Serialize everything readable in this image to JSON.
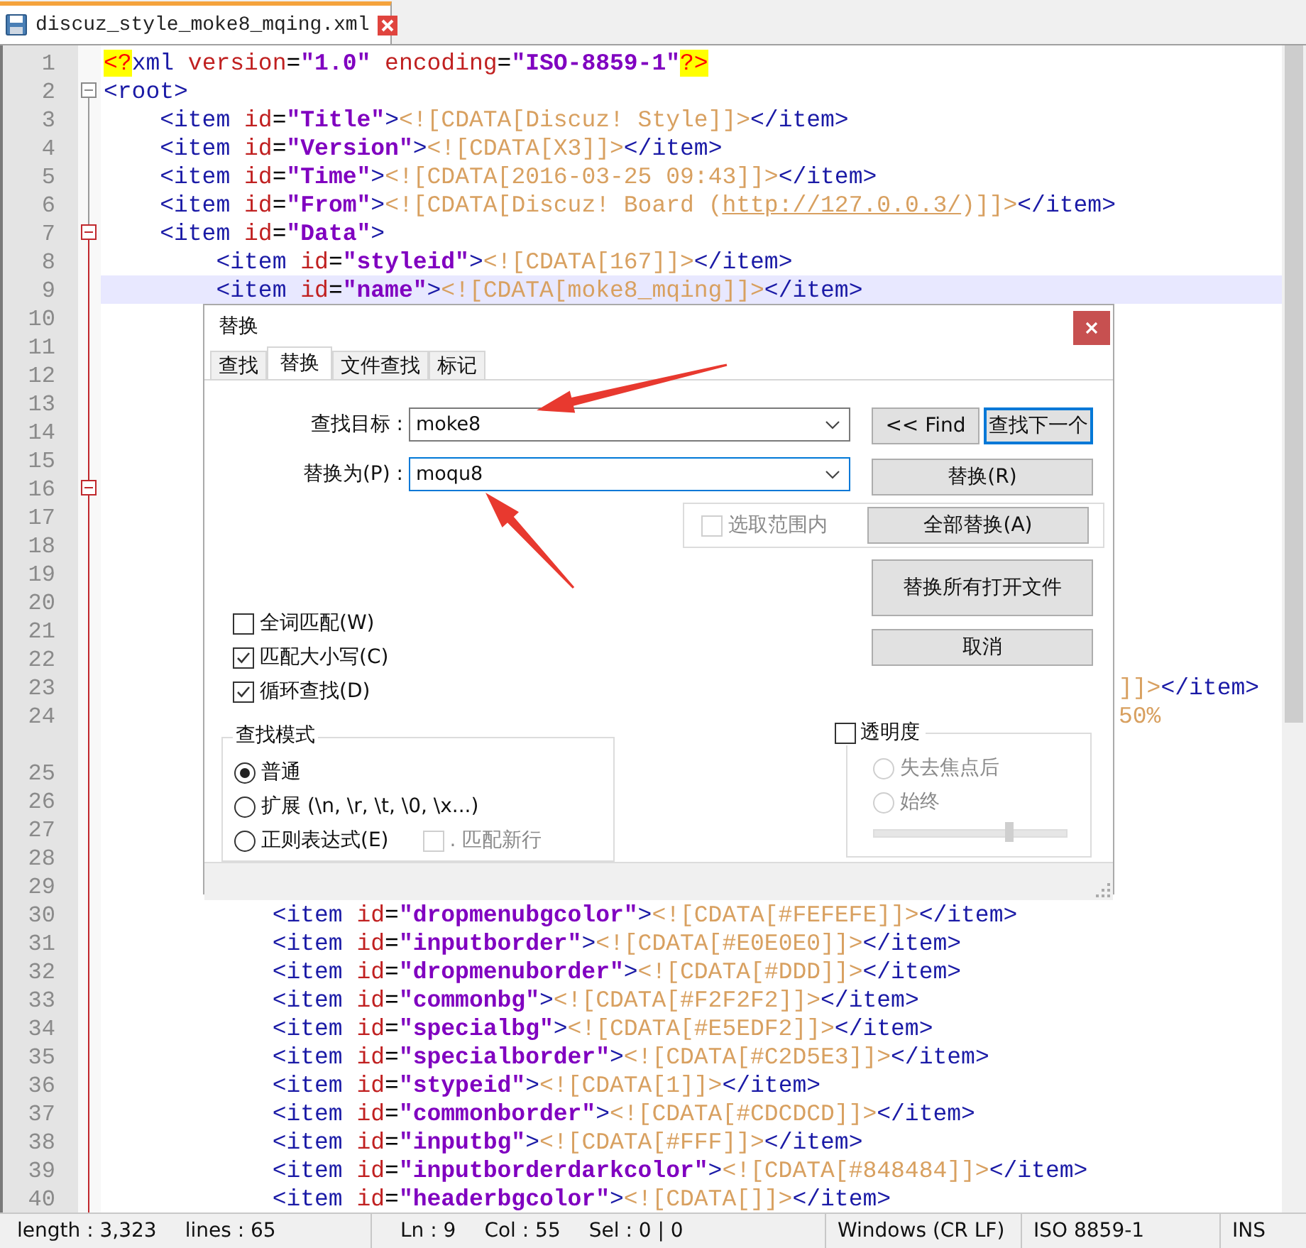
{
  "tab": {
    "title": "discuz_style_moke8_mqing.xml"
  },
  "editor": {
    "lines": [
      {
        "number": "1",
        "current": false,
        "segments": [
          {
            "kind": "pi",
            "text": "<?"
          },
          {
            "kind": "tag",
            "text": "xml "
          },
          {
            "kind": "attr",
            "text": "version"
          },
          {
            "kind": "plain",
            "text": "="
          },
          {
            "kind": "value",
            "text": "\"1.0\""
          },
          {
            "kind": "attr",
            "text": " encoding"
          },
          {
            "kind": "plain",
            "text": "="
          },
          {
            "kind": "value",
            "text": "\"ISO-8859-1\""
          },
          {
            "kind": "pi",
            "text": "?>"
          }
        ]
      },
      {
        "number": "2",
        "current": false,
        "fold": true,
        "fold_current": false,
        "segments": [
          {
            "kind": "tag",
            "text": "<root>"
          }
        ]
      },
      {
        "number": "3",
        "current": false,
        "segments": [
          {
            "kind": "tag",
            "text": "    <item "
          },
          {
            "kind": "attr",
            "text": "id"
          },
          {
            "kind": "plain",
            "text": "="
          },
          {
            "kind": "value",
            "text": "\"Title\""
          },
          {
            "kind": "tag",
            "text": ">"
          },
          {
            "kind": "cdata",
            "text": "<![CDATA[Discuz! Style]]>"
          },
          {
            "kind": "tag",
            "text": "</item>"
          }
        ]
      },
      {
        "number": "4",
        "current": false,
        "segments": [
          {
            "kind": "tag",
            "text": "    <item "
          },
          {
            "kind": "attr",
            "text": "id"
          },
          {
            "kind": "plain",
            "text": "="
          },
          {
            "kind": "value",
            "text": "\"Version\""
          },
          {
            "kind": "tag",
            "text": ">"
          },
          {
            "kind": "cdata",
            "text": "<![CDATA[X3]]>"
          },
          {
            "kind": "tag",
            "text": "</item>"
          }
        ]
      },
      {
        "number": "5",
        "current": false,
        "segments": [
          {
            "kind": "tag",
            "text": "    <item "
          },
          {
            "kind": "attr",
            "text": "id"
          },
          {
            "kind": "plain",
            "text": "="
          },
          {
            "kind": "value",
            "text": "\"Time\""
          },
          {
            "kind": "tag",
            "text": ">"
          },
          {
            "kind": "cdata",
            "text": "<![CDATA[2016-03-25 09:43]]>"
          },
          {
            "kind": "tag",
            "text": "</item>"
          }
        ]
      },
      {
        "number": "6",
        "current": false,
        "segments": [
          {
            "kind": "tag",
            "text": "    <item "
          },
          {
            "kind": "attr",
            "text": "id"
          },
          {
            "kind": "plain",
            "text": "="
          },
          {
            "kind": "value",
            "text": "\"From\""
          },
          {
            "kind": "tag",
            "text": ">"
          },
          {
            "kind": "cdata",
            "text": "<![CDATA[Discuz! Board ("
          },
          {
            "kind": "link",
            "text": "http://127.0.0.3/"
          },
          {
            "kind": "cdata",
            "text": ")]]>"
          },
          {
            "kind": "tag",
            "text": "</item>"
          }
        ]
      },
      {
        "number": "7",
        "current": false,
        "fold": true,
        "fold_current": true,
        "segments": [
          {
            "kind": "tag",
            "text": "    <item "
          },
          {
            "kind": "attr",
            "text": "id"
          },
          {
            "kind": "plain",
            "text": "="
          },
          {
            "kind": "value",
            "text": "\"Data\""
          },
          {
            "kind": "tag",
            "text": ">"
          }
        ]
      },
      {
        "number": "8",
        "current": false,
        "segments": [
          {
            "kind": "tag",
            "text": "        <item "
          },
          {
            "kind": "attr",
            "text": "id"
          },
          {
            "kind": "plain",
            "text": "="
          },
          {
            "kind": "value",
            "text": "\"styleid\""
          },
          {
            "kind": "tag",
            "text": ">"
          },
          {
            "kind": "cdata",
            "text": "<![CDATA[167]]>"
          },
          {
            "kind": "tag",
            "text": "</item>"
          }
        ]
      },
      {
        "number": "9",
        "current": true,
        "segments": [
          {
            "kind": "tag",
            "text": "        <item "
          },
          {
            "kind": "attr",
            "text": "id"
          },
          {
            "kind": "plain",
            "text": "="
          },
          {
            "kind": "value",
            "text": "\"name\""
          },
          {
            "kind": "tag",
            "text": ">"
          },
          {
            "kind": "cdata",
            "text": "<![CDATA[moke8_mqing]]>"
          },
          {
            "kind": "tag",
            "text": "</item>"
          }
        ]
      },
      {
        "number": "10",
        "current": false
      },
      {
        "number": "11",
        "current": false
      },
      {
        "number": "12",
        "current": false
      },
      {
        "number": "13",
        "current": false
      },
      {
        "number": "14",
        "current": false
      },
      {
        "number": "15",
        "current": false
      },
      {
        "number": "16",
        "current": false,
        "fold": true,
        "fold_current": true
      },
      {
        "number": "17",
        "current": false
      },
      {
        "number": "18",
        "current": false
      },
      {
        "number": "19",
        "current": false
      },
      {
        "number": "20",
        "current": false
      },
      {
        "number": "21",
        "current": false
      },
      {
        "number": "22",
        "current": false
      },
      {
        "number": "23",
        "current": false,
        "fragment": true,
        "segments": [
          {
            "kind": "cdata",
            "text": "]]>"
          },
          {
            "kind": "tag",
            "text": "</item>"
          }
        ]
      },
      {
        "number": "24",
        "current": false,
        "fragment": true,
        "wrapped": true,
        "segments": [
          {
            "kind": "cdata",
            "text": "50%"
          }
        ]
      },
      {
        "number": "25",
        "current": false
      },
      {
        "number": "26",
        "current": false
      },
      {
        "number": "27",
        "current": false
      },
      {
        "number": "28",
        "current": false
      },
      {
        "number": "29",
        "current": false
      },
      {
        "number": "30",
        "current": false,
        "segments": [
          {
            "kind": "tag",
            "text": "            <item "
          },
          {
            "kind": "attr",
            "text": "id"
          },
          {
            "kind": "plain",
            "text": "="
          },
          {
            "kind": "value",
            "text": "\"dropmenubgcolor\""
          },
          {
            "kind": "tag",
            "text": ">"
          },
          {
            "kind": "cdata",
            "text": "<![CDATA[#FEFEFE]]>"
          },
          {
            "kind": "tag",
            "text": "</item>"
          }
        ]
      },
      {
        "number": "31",
        "current": false,
        "segments": [
          {
            "kind": "tag",
            "text": "            <item "
          },
          {
            "kind": "attr",
            "text": "id"
          },
          {
            "kind": "plain",
            "text": "="
          },
          {
            "kind": "value",
            "text": "\"inputborder\""
          },
          {
            "kind": "tag",
            "text": ">"
          },
          {
            "kind": "cdata",
            "text": "<![CDATA[#E0E0E0]]>"
          },
          {
            "kind": "tag",
            "text": "</item>"
          }
        ]
      },
      {
        "number": "32",
        "current": false,
        "segments": [
          {
            "kind": "tag",
            "text": "            <item "
          },
          {
            "kind": "attr",
            "text": "id"
          },
          {
            "kind": "plain",
            "text": "="
          },
          {
            "kind": "value",
            "text": "\"dropmenuborder\""
          },
          {
            "kind": "tag",
            "text": ">"
          },
          {
            "kind": "cdata",
            "text": "<![CDATA[#DDD]]>"
          },
          {
            "kind": "tag",
            "text": "</item>"
          }
        ]
      },
      {
        "number": "33",
        "current": false,
        "segments": [
          {
            "kind": "tag",
            "text": "            <item "
          },
          {
            "kind": "attr",
            "text": "id"
          },
          {
            "kind": "plain",
            "text": "="
          },
          {
            "kind": "value",
            "text": "\"commonbg\""
          },
          {
            "kind": "tag",
            "text": ">"
          },
          {
            "kind": "cdata",
            "text": "<![CDATA[#F2F2F2]]>"
          },
          {
            "kind": "tag",
            "text": "</item>"
          }
        ]
      },
      {
        "number": "34",
        "current": false,
        "segments": [
          {
            "kind": "tag",
            "text": "            <item "
          },
          {
            "kind": "attr",
            "text": "id"
          },
          {
            "kind": "plain",
            "text": "="
          },
          {
            "kind": "value",
            "text": "\"specialbg\""
          },
          {
            "kind": "tag",
            "text": ">"
          },
          {
            "kind": "cdata",
            "text": "<![CDATA[#E5EDF2]]>"
          },
          {
            "kind": "tag",
            "text": "</item>"
          }
        ]
      },
      {
        "number": "35",
        "current": false,
        "segments": [
          {
            "kind": "tag",
            "text": "            <item "
          },
          {
            "kind": "attr",
            "text": "id"
          },
          {
            "kind": "plain",
            "text": "="
          },
          {
            "kind": "value",
            "text": "\"specialborder\""
          },
          {
            "kind": "tag",
            "text": ">"
          },
          {
            "kind": "cdata",
            "text": "<![CDATA[#C2D5E3]]>"
          },
          {
            "kind": "tag",
            "text": "</item>"
          }
        ]
      },
      {
        "number": "36",
        "current": false,
        "segments": [
          {
            "kind": "tag",
            "text": "            <item "
          },
          {
            "kind": "attr",
            "text": "id"
          },
          {
            "kind": "plain",
            "text": "="
          },
          {
            "kind": "value",
            "text": "\"stypeid\""
          },
          {
            "kind": "tag",
            "text": ">"
          },
          {
            "kind": "cdata",
            "text": "<![CDATA[1]]>"
          },
          {
            "kind": "tag",
            "text": "</item>"
          }
        ]
      },
      {
        "number": "37",
        "current": false,
        "segments": [
          {
            "kind": "tag",
            "text": "            <item "
          },
          {
            "kind": "attr",
            "text": "id"
          },
          {
            "kind": "plain",
            "text": "="
          },
          {
            "kind": "value",
            "text": "\"commonborder\""
          },
          {
            "kind": "tag",
            "text": ">"
          },
          {
            "kind": "cdata",
            "text": "<![CDATA[#CDCDCD]]>"
          },
          {
            "kind": "tag",
            "text": "</item>"
          }
        ]
      },
      {
        "number": "38",
        "current": false,
        "segments": [
          {
            "kind": "tag",
            "text": "            <item "
          },
          {
            "kind": "attr",
            "text": "id"
          },
          {
            "kind": "plain",
            "text": "="
          },
          {
            "kind": "value",
            "text": "\"inputbg\""
          },
          {
            "kind": "tag",
            "text": ">"
          },
          {
            "kind": "cdata",
            "text": "<![CDATA[#FFF]]>"
          },
          {
            "kind": "tag",
            "text": "</item>"
          }
        ]
      },
      {
        "number": "39",
        "current": false,
        "segments": [
          {
            "kind": "tag",
            "text": "            <item "
          },
          {
            "kind": "attr",
            "text": "id"
          },
          {
            "kind": "plain",
            "text": "="
          },
          {
            "kind": "value",
            "text": "\"inputborderdarkcolor\""
          },
          {
            "kind": "tag",
            "text": ">"
          },
          {
            "kind": "cdata",
            "text": "<![CDATA[#848484]]>"
          },
          {
            "kind": "tag",
            "text": "</item>"
          }
        ]
      },
      {
        "number": "40",
        "current": false,
        "segments": [
          {
            "kind": "tag",
            "text": "            <item "
          },
          {
            "kind": "attr",
            "text": "id"
          },
          {
            "kind": "plain",
            "text": "="
          },
          {
            "kind": "value",
            "text": "\"headerbgcolor\""
          },
          {
            "kind": "tag",
            "text": ">"
          },
          {
            "kind": "cdata",
            "text": "<![CDATA[]]>"
          },
          {
            "kind": "tag",
            "text": "</item>"
          }
        ]
      }
    ]
  },
  "dialog": {
    "title": "替换",
    "tabs": [
      {
        "label": "查找",
        "selected": false
      },
      {
        "label": "替换",
        "selected": true
      },
      {
        "label": "文件查找",
        "selected": false
      },
      {
        "label": "标记",
        "selected": false
      }
    ],
    "fields": [
      {
        "label": "查找目标 :",
        "value": "moke8",
        "focused": false
      },
      {
        "label": "替换为(P) :",
        "value": "moqu8",
        "focused": true
      }
    ],
    "find_buttons": [
      {
        "label": "<< Find",
        "focused": false
      },
      {
        "label": "查找下一个",
        "focused": true
      }
    ],
    "replace_button": "替换(R)",
    "in_selection": {
      "label": "选取范围内",
      "checked": false,
      "disabled": true
    },
    "replace_all_button": "全部替换(A)",
    "replace_all_files_button": "替换所有打开文件",
    "cancel_button": "取消",
    "options": [
      {
        "label": "全词匹配(W)",
        "checked": false
      },
      {
        "label": "匹配大小写(C)",
        "checked": true
      },
      {
        "label": "循环查找(D)",
        "checked": true
      }
    ],
    "search_mode": {
      "title": "查找模式",
      "modes": [
        {
          "label": "普通",
          "selected": true
        },
        {
          "label": "扩展 (\\n, \\r, \\t, \\0, \\x...)",
          "selected": false
        },
        {
          "label": "正则表达式(E)",
          "selected": false
        }
      ],
      "dot_newline": {
        "label": ". 匹配新行",
        "checked": false,
        "disabled": true
      }
    },
    "transparency": {
      "label": "透明度",
      "checked": false,
      "modes": [
        {
          "label": "失去焦点后",
          "selected": false
        },
        {
          "label": "始终",
          "selected": false
        }
      ],
      "level": 0.7
    }
  },
  "status_bar": [
    {
      "items": [
        "length : 3,323",
        "lines : 65"
      ]
    },
    {
      "items": [
        "Ln : 9",
        "Col : 55",
        "Sel : 0 | 0"
      ]
    },
    {
      "items": [
        "Windows (CR LF)"
      ]
    },
    {
      "items": [
        "ISO 8859-1"
      ]
    },
    {
      "items": [
        "INS"
      ]
    }
  ]
}
